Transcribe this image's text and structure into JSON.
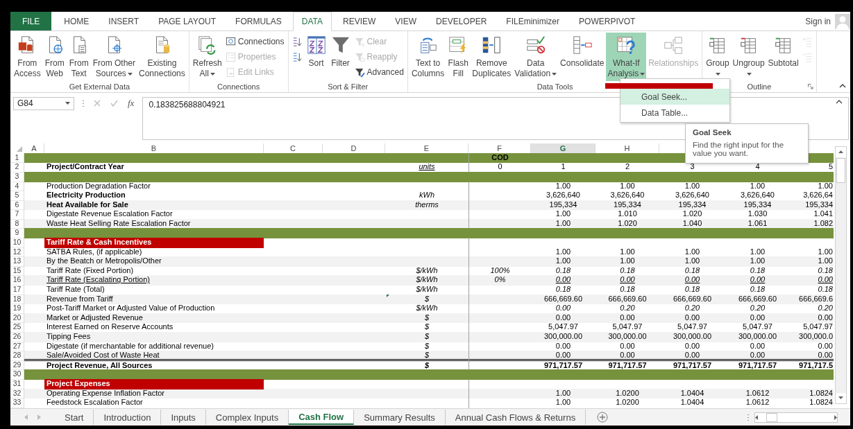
{
  "ribbon": {
    "tabs": [
      {
        "label": "FILE",
        "kind": "file",
        "selected": false
      },
      {
        "label": "HOME",
        "kind": "tab",
        "selected": false
      },
      {
        "label": "INSERT",
        "kind": "tab",
        "selected": false
      },
      {
        "label": "PAGE LAYOUT",
        "kind": "tab",
        "selected": false
      },
      {
        "label": "FORMULAS",
        "kind": "tab",
        "selected": false
      },
      {
        "label": "DATA",
        "kind": "tab",
        "selected": true
      },
      {
        "label": "REVIEW",
        "kind": "tab",
        "selected": false
      },
      {
        "label": "VIEW",
        "kind": "tab",
        "selected": false
      },
      {
        "label": "DEVELOPER",
        "kind": "tab",
        "selected": false
      },
      {
        "label": "FILEminimizer",
        "kind": "tab",
        "selected": false
      },
      {
        "label": "POWERPIVOT",
        "kind": "tab",
        "selected": false
      }
    ],
    "sign_in": "Sign in",
    "groups": [
      {
        "label": "Get External Data",
        "launcher": false,
        "controls": [
          {
            "kind": "large",
            "lines": [
              "From",
              "Access"
            ],
            "dropdown": false,
            "disabled": false,
            "pressed": false
          },
          {
            "kind": "large",
            "lines": [
              "From",
              "Web"
            ],
            "dropdown": false,
            "disabled": false,
            "pressed": false
          },
          {
            "kind": "large",
            "lines": [
              "From",
              "Text"
            ],
            "dropdown": false,
            "disabled": false,
            "pressed": false
          },
          {
            "kind": "large",
            "lines": [
              "From Other",
              "Sources"
            ],
            "dropdown": true,
            "disabled": false,
            "pressed": false
          },
          {
            "kind": "large",
            "lines": [
              "Existing",
              "Connections"
            ],
            "dropdown": false,
            "disabled": false,
            "pressed": false
          }
        ]
      },
      {
        "label": "Connections",
        "launcher": false,
        "controls": [
          {
            "kind": "large",
            "lines": [
              "Refresh",
              "All"
            ],
            "dropdown": true,
            "disabled": false,
            "pressed": false
          },
          {
            "kind": "stack",
            "items": [
              {
                "label": "Connections",
                "disabled": false
              },
              {
                "label": "Properties",
                "disabled": true
              },
              {
                "label": "Edit Links",
                "disabled": true
              }
            ]
          }
        ]
      },
      {
        "label": "Sort & Filter",
        "launcher": false,
        "controls": [
          {
            "kind": "stack",
            "items": [
              {
                "disabled": false
              },
              {
                "disabled": false
              }
            ]
          },
          {
            "kind": "large",
            "lines": [
              "Sort"
            ],
            "dropdown": false,
            "disabled": false,
            "pressed": false
          },
          {
            "kind": "large",
            "lines": [
              "Filter"
            ],
            "dropdown": false,
            "disabled": false,
            "pressed": false
          },
          {
            "kind": "stack",
            "items": [
              {
                "label": "Clear",
                "disabled": true
              },
              {
                "label": "Reapply",
                "disabled": true
              },
              {
                "label": "Advanced",
                "disabled": false
              }
            ]
          }
        ]
      },
      {
        "label": "Data Tools",
        "launcher": false,
        "controls": [
          {
            "kind": "large",
            "lines": [
              "Text to",
              "Columns"
            ],
            "dropdown": false,
            "disabled": false,
            "pressed": false
          },
          {
            "kind": "large",
            "lines": [
              "Flash",
              "Fill"
            ],
            "dropdown": false,
            "disabled": false,
            "pressed": false
          },
          {
            "kind": "large",
            "lines": [
              "Remove",
              "Duplicates"
            ],
            "dropdown": false,
            "disabled": false,
            "pressed": false
          },
          {
            "kind": "large",
            "lines": [
              "Data",
              "Validation"
            ],
            "dropdown": true,
            "disabled": false,
            "pressed": false
          },
          {
            "kind": "large",
            "lines": [
              "Consolidate"
            ],
            "dropdown": false,
            "disabled": false,
            "pressed": false
          },
          {
            "kind": "large",
            "lines": [
              "What-If",
              "Analysis"
            ],
            "dropdown": true,
            "disabled": false,
            "pressed": true
          },
          {
            "kind": "large",
            "lines": [
              "Relationships"
            ],
            "dropdown": false,
            "disabled": true,
            "pressed": false
          }
        ]
      },
      {
        "label": "Outline",
        "launcher": true,
        "controls": [
          {
            "kind": "large",
            "lines": [
              "Group"
            ],
            "dropdown": true,
            "disabled": false,
            "pressed": false
          },
          {
            "kind": "large",
            "lines": [
              "Ungroup"
            ],
            "dropdown": true,
            "disabled": false,
            "pressed": false
          },
          {
            "kind": "large",
            "lines": [
              "Subtotal"
            ],
            "dropdown": false,
            "disabled": false,
            "pressed": false
          },
          {
            "kind": "stack",
            "items": [
              {
                "disabled": true
              },
              {
                "disabled": true
              }
            ]
          }
        ]
      }
    ]
  },
  "menu": {
    "items": [
      {
        "kind": "redacted",
        "selected": false
      },
      {
        "kind": "item",
        "label": "Goal Seek...",
        "selected": true
      },
      {
        "kind": "item",
        "label": "Data Table...",
        "selected": false
      }
    ]
  },
  "tooltip": {
    "title": "Goal Seek",
    "text": "Find the right input for the value you want."
  },
  "formula_bar": {
    "name_box": "G84",
    "function_label": "fx",
    "value": "0.183825688804921"
  },
  "columns": [
    {
      "label": "A",
      "selected": false
    },
    {
      "label": "B",
      "selected": false
    },
    {
      "label": "C",
      "selected": false
    },
    {
      "label": "D",
      "selected": false
    },
    {
      "label": "E",
      "selected": false
    },
    {
      "label": "F",
      "selected": false
    },
    {
      "label": "G",
      "selected": true
    },
    {
      "label": "H",
      "selected": false
    }
  ],
  "rows": [
    {
      "num": "1",
      "kind": "band",
      "cells": [
        "COD",
        null,
        null,
        null,
        null,
        null
      ]
    },
    {
      "num": "2",
      "kind": "year",
      "shaded": false,
      "comment": false,
      "label": "Project/Contract Year",
      "unit": "units",
      "cells": [
        "0",
        "1",
        "2",
        "3",
        "4",
        "5"
      ]
    },
    {
      "num": "3",
      "kind": "band"
    },
    {
      "num": "4",
      "kind": "data",
      "shaded": false,
      "comment": false,
      "label": "Production Degradation Factor",
      "cells": [
        null,
        "1.00",
        "1.00",
        "1.00",
        "1.00",
        "1.00"
      ]
    },
    {
      "num": "5",
      "kind": "heading",
      "shaded": false,
      "comment": false,
      "label": "Electricity Production",
      "unit": "kWh",
      "cells": [
        null,
        "3,626,640",
        "3,626,640",
        "3,626,640",
        "3,626,640",
        "3,626,64"
      ]
    },
    {
      "num": "6",
      "kind": "heading",
      "shaded": true,
      "comment": false,
      "label": "Heat Available for Sale",
      "unit": "therms",
      "cells": [
        null,
        "195,334",
        "195,334",
        "195,334",
        "195,334",
        "195,334"
      ]
    },
    {
      "num": "7",
      "kind": "data",
      "shaded": false,
      "comment": false,
      "label": "Digestate Revenue Escalation Factor",
      "cells": [
        null,
        "1.00",
        "1.010",
        "1.020",
        "1.030",
        "1.041"
      ]
    },
    {
      "num": "8",
      "kind": "data",
      "shaded": true,
      "comment": false,
      "label": "Waste Heat Selling Rate Escalation Factor",
      "cells": [
        null,
        "1.00",
        "1.020",
        "1.040",
        "1.061",
        "1.082"
      ]
    },
    {
      "num": "9",
      "kind": "band"
    },
    {
      "num": "10",
      "kind": "section",
      "shaded": false,
      "label": "Tariff Rate & Cash Incentives"
    },
    {
      "num": "12",
      "kind": "data",
      "shaded": false,
      "comment": false,
      "label": "SATBA Rules, (if applicable)",
      "cells": [
        null,
        "1.00",
        "1.00",
        "1.00",
        "1.00",
        "1.00"
      ]
    },
    {
      "num": "13",
      "kind": "data",
      "shaded": true,
      "comment": false,
      "label": "By the Beatch or Metropolis/Other",
      "cells": [
        null,
        "1.00",
        "1.00",
        "1.00",
        "1.00",
        "1.00"
      ]
    },
    {
      "num": "15",
      "kind": "rate",
      "shaded": false,
      "comment": false,
      "label": "Tariff Rate (Fixed Portion)",
      "unit": "$/kWh",
      "cells": [
        "100%",
        "0.18",
        "0.18",
        "0.18",
        "0.18",
        "0.18"
      ]
    },
    {
      "num": "16",
      "kind": "rate_underlined",
      "shaded": true,
      "comment": false,
      "label": "Tariff Rate (Escalating Portion)",
      "unit": "$/kWh",
      "cells": [
        "0%",
        "0.00",
        "0.00",
        "0.00",
        "0.00",
        "0.00"
      ]
    },
    {
      "num": "17",
      "kind": "rate",
      "shaded": false,
      "comment": false,
      "label": "Tariff Rate (Total)",
      "unit": "$/kWh",
      "cells": [
        null,
        "0.18",
        "0.18",
        "0.18",
        "0.18",
        "0.18"
      ]
    },
    {
      "num": "18",
      "kind": "data",
      "shaded": true,
      "comment": true,
      "label": "Revenue from Tariff",
      "unit": "$",
      "cells": [
        null,
        "666,669.60",
        "666,669.60",
        "666,669.60",
        "666,669.60",
        "666,669.6"
      ]
    },
    {
      "num": "19",
      "kind": "rate",
      "shaded": false,
      "comment": false,
      "label": "Post-Tariff Market or Adjusted Value of Production",
      "unit": "$/kWh",
      "cells": [
        null,
        "0.00",
        "0.20",
        "0.20",
        "0.20",
        "0.20"
      ]
    },
    {
      "num": "20",
      "kind": "data",
      "shaded": true,
      "comment": false,
      "label": "Market or Adjusted Revenue",
      "unit": "$",
      "cells": [
        null,
        "0.00",
        "0.00",
        "0.00",
        "0.00",
        "0.00"
      ]
    },
    {
      "num": "25",
      "kind": "data",
      "shaded": false,
      "comment": false,
      "label": "Interest Earned on Reserve Accounts",
      "unit": "$",
      "cells": [
        null,
        "5,047.97",
        "5,047.97",
        "5,047.97",
        "5,047.97",
        "5,047.97"
      ]
    },
    {
      "num": "26",
      "kind": "data",
      "shaded": true,
      "comment": false,
      "label": "Tipping Fees",
      "unit": "$",
      "cells": [
        null,
        "300,000.00",
        "300,000.00",
        "300,000.00",
        "300,000.00",
        "300,000.0"
      ]
    },
    {
      "num": "27",
      "kind": "data",
      "shaded": false,
      "comment": false,
      "label": "Digestate (if merchantable for additional revenue)",
      "unit": "$",
      "cells": [
        null,
        "0.00",
        "0.00",
        "0.00",
        "0.00",
        "0.00"
      ]
    },
    {
      "num": "28",
      "kind": "data",
      "shaded": true,
      "comment": false,
      "label": "Sale/Avoided Cost of Waste Heat",
      "unit": "$",
      "cells": [
        null,
        "0.00",
        "0.00",
        "0.00",
        "0.00",
        "0.00"
      ]
    },
    {
      "num": "29",
      "kind": "total",
      "shaded": false,
      "comment": false,
      "label": "Project Revenue, All Sources",
      "unit": "$",
      "cells": [
        null,
        "971,717.57",
        "971,717.57",
        "971,717.57",
        "971,717.57",
        "971,717.5"
      ]
    },
    {
      "num": "30",
      "kind": "band"
    },
    {
      "num": "31",
      "kind": "section",
      "shaded": false,
      "label": "Project Expenses"
    },
    {
      "num": "32",
      "kind": "data",
      "shaded": true,
      "comment": false,
      "label": "Operating Expense Inflation Factor",
      "cells": [
        null,
        "1.00",
        "1.0200",
        "1.0404",
        "1.0612",
        "1.0824"
      ]
    },
    {
      "num": "33",
      "kind": "data",
      "shaded": false,
      "comment": false,
      "label": "Feedstock Escalation Factor",
      "cells": [
        null,
        "1.00",
        "1.0200",
        "1.0404",
        "1.0612",
        "1.0824"
      ]
    }
  ],
  "sheet_tabs": [
    {
      "label": "Start",
      "selected": false
    },
    {
      "label": "Introduction",
      "selected": false
    },
    {
      "label": "Inputs",
      "selected": false
    },
    {
      "label": "Complex Inputs",
      "selected": false
    },
    {
      "label": "Cash Flow",
      "selected": true
    },
    {
      "label": "Summary Results",
      "selected": false
    },
    {
      "label": "Annual Cash Flows & Returns",
      "selected": false
    }
  ]
}
